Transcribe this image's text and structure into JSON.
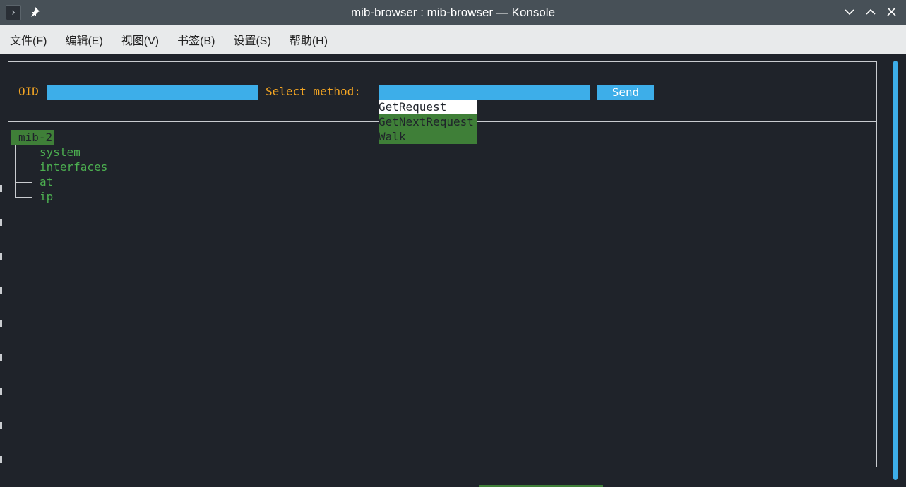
{
  "window": {
    "title": "mib-browser : mib-browser — Konsole",
    "app_icon": "terminal-prompt-icon",
    "pin_icon": "pin-icon"
  },
  "menu": [
    "文件(F)",
    "编辑(E)",
    "视图(V)",
    "书签(B)",
    "设置(S)",
    "帮助(H)"
  ],
  "form": {
    "oid_label": "OID",
    "oid_value": "",
    "method_label": "Select method:",
    "method_value": "",
    "send_label": "Send"
  },
  "dropdown": {
    "selected": "GetRequest",
    "options": [
      "GetRequest",
      "GetNextRequest",
      "Walk"
    ]
  },
  "tree": {
    "root": "mib-2",
    "children": [
      "system",
      "interfaces",
      "at",
      "ip"
    ]
  },
  "colors": {
    "accent": "#3daee9",
    "label": "#f5a623",
    "tree_text": "#4caf50",
    "highlight": "#3f7f38",
    "background": "#1f232a"
  }
}
